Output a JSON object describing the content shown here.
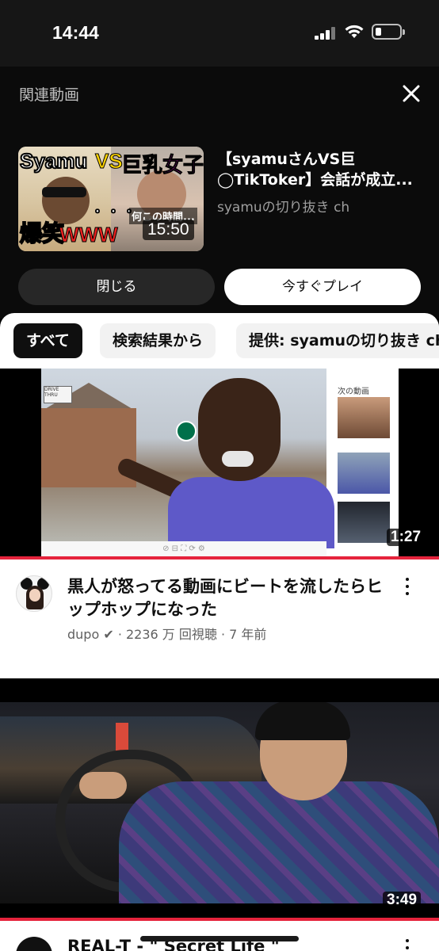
{
  "status_bar": {
    "time": "14:44"
  },
  "related_panel": {
    "heading": "関連動画",
    "video": {
      "title": "【syamuさんVS巨◯TikToker】会話が成立...",
      "channel": "syamuの切り抜き ch",
      "duration": "15:50",
      "thumb_text": {
        "name": "Syamu",
        "vs": "VS",
        "girl": "巨乳女子",
        "laugh": "爆笑",
        "www": "WWW",
        "dots": "・・・",
        "caption": "何この時間..."
      }
    },
    "close_label": "閉じる",
    "play_label": "今すぐプレイ"
  },
  "chips": [
    {
      "label": "すべて",
      "active": true
    },
    {
      "label": "検索結果から",
      "active": false
    },
    {
      "label": "提供: syamuの切り抜き ch",
      "active": false
    }
  ],
  "videos": [
    {
      "title": "黒人が怒ってる動画にビートを流したらヒップホップになった",
      "meta": "dupo ✔ · 2236 万 回視聴 · 7 年前",
      "duration": "1:27",
      "thumb_text": {
        "sign": "DRIVE THRU",
        "sidebar_label": "次の動画",
        "controls": "⊘ ⊟ ⛶ ⟳ ⚙"
      }
    },
    {
      "title": "REAL-T - \" Secret Life \"",
      "duration": "3:49"
    }
  ],
  "colors": {
    "accent_red": "#e5233c",
    "chip_active": "#0f0f0f"
  }
}
